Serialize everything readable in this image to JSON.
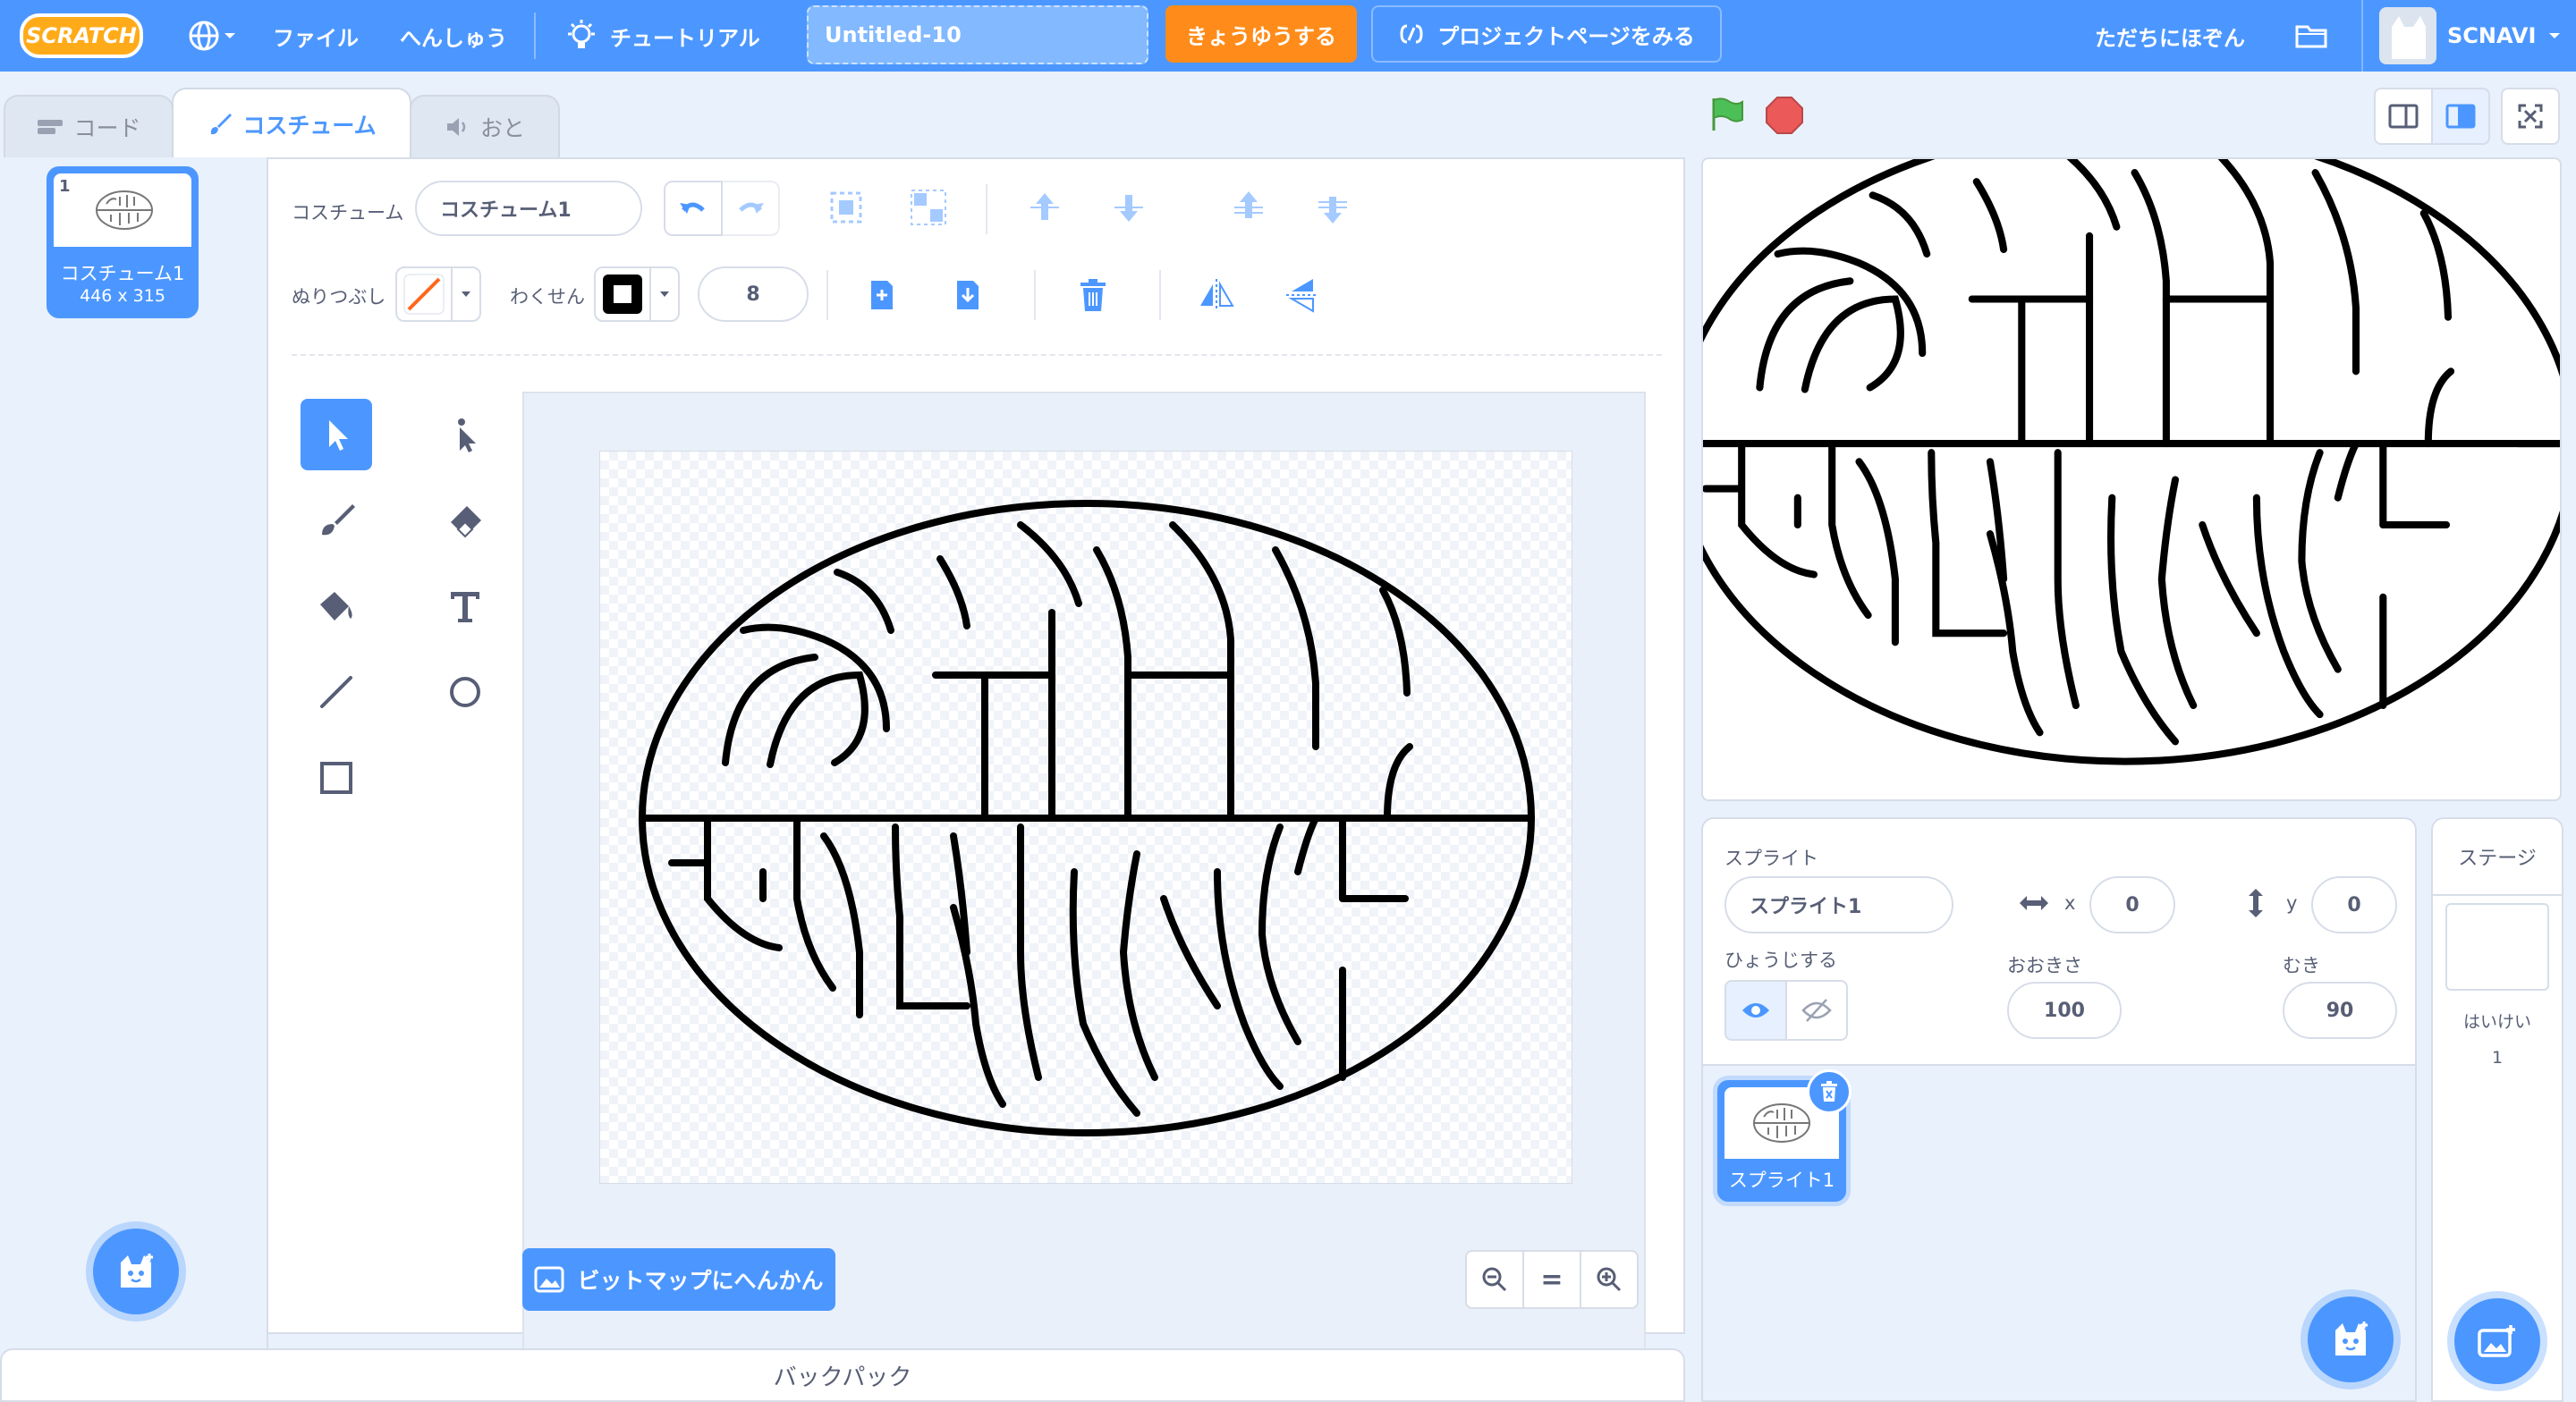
{
  "menu": {
    "logo": "SCRATCH",
    "file": "ファイル",
    "edit": "へんしゅう",
    "tutorials": "チュートリアル",
    "project_title": "Untitled-10",
    "share": "きょうゆうする",
    "project_page": "プロジェクトページをみる",
    "save_now": "ただちにほぞん",
    "username": "SCNAVI"
  },
  "tabs": {
    "code": "コード",
    "costumes": "コスチューム",
    "sounds": "おと"
  },
  "costume_list": [
    {
      "index": "1",
      "name": "コスチューム1",
      "size": "446 x 315"
    }
  ],
  "editor": {
    "costume_label": "コスチューム",
    "costume_name": "コスチューム1",
    "fill_label": "ぬりつぶし",
    "outline_label": "わくせん",
    "outline_width": "8",
    "convert_bitmap": "ビットマップにへんかん",
    "zoom_reset": "="
  },
  "backpack": "バックパック",
  "sprite_info": {
    "label": "スプライト",
    "name": "スプライト1",
    "x_label": "x",
    "x": "0",
    "y_label": "y",
    "y": "0",
    "show_label": "ひょうじする",
    "size_label": "おおきさ",
    "size": "100",
    "direction_label": "むき",
    "direction": "90"
  },
  "sprites": [
    {
      "name": "スプライト1"
    }
  ],
  "stage_panel": {
    "title": "ステージ",
    "backdrops_label": "はいけい",
    "backdrops_count": "1"
  },
  "colors": {
    "accent": "#4c97ff",
    "share_orange": "#ff8c1a",
    "flag_green": "#4cbf56",
    "stop_red": "#ec5959",
    "fill_swatch": "#ff6619",
    "outline_swatch": "#000000"
  }
}
